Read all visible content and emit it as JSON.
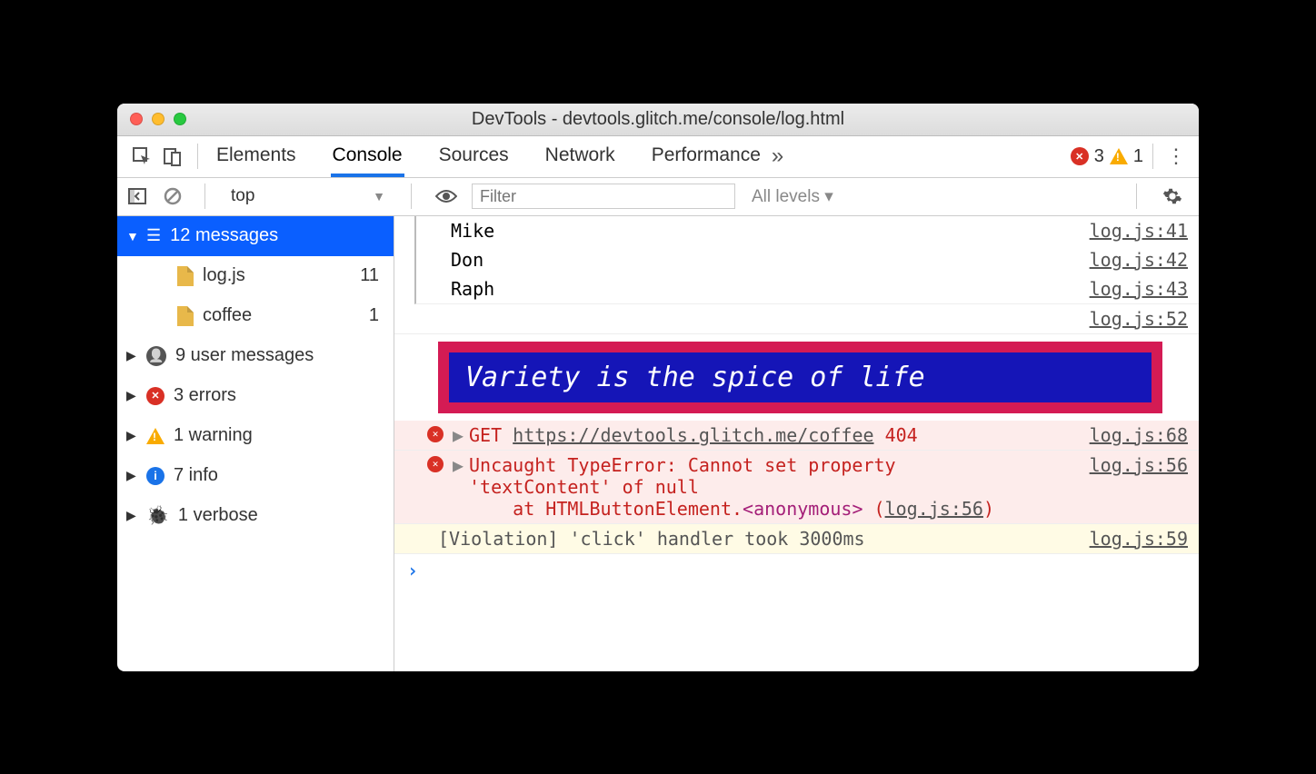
{
  "window": {
    "title": "DevTools - devtools.glitch.me/console/log.html"
  },
  "tabs": {
    "items": [
      "Elements",
      "Console",
      "Sources",
      "Network",
      "Performance"
    ],
    "overflow": "»",
    "active": "Console"
  },
  "toolbar_counts": {
    "errors": "3",
    "warnings": "1"
  },
  "filterbar": {
    "context": "top",
    "filter_placeholder": "Filter",
    "levels": "All levels ▾"
  },
  "sidebar": {
    "messages": {
      "label": "12 messages"
    },
    "files": [
      {
        "name": "log.js",
        "count": "11"
      },
      {
        "name": "coffee",
        "count": "1"
      }
    ],
    "user_messages": {
      "label": "9 user messages"
    },
    "errors": {
      "label": "3 errors"
    },
    "warnings": {
      "label": "1 warning"
    },
    "info": {
      "label": "7 info"
    },
    "verbose": {
      "label": "1 verbose"
    }
  },
  "console": {
    "rows": [
      {
        "text": "Mike",
        "src": "log.js:41"
      },
      {
        "text": "Don",
        "src": "log.js:42"
      },
      {
        "text": "Raph",
        "src": "log.js:43"
      }
    ],
    "groupend_src": "log.js:52",
    "styled_text": "Variety is the spice of life",
    "get_error": {
      "method": "GET",
      "url": "https://devtools.glitch.me/coffee",
      "status": "404",
      "src": "log.js:68"
    },
    "type_error": {
      "line1": "Uncaught TypeError: Cannot set property",
      "line2": "'textContent' of null",
      "line3a": "    at HTMLButtonElement.",
      "line3_anon": "<anonymous>",
      "line3b": " (",
      "line3_link": "log.js:56",
      "line3c": ")",
      "src": "log.js:56"
    },
    "violation": {
      "text": "[Violation] 'click' handler took 3000ms",
      "src": "log.js:59"
    },
    "prompt": "›"
  }
}
